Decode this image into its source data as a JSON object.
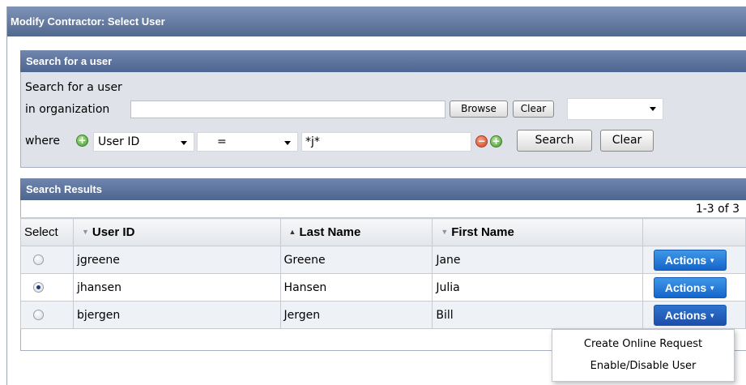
{
  "page": {
    "title": "Modify Contractor: Select User"
  },
  "search_panel": {
    "title": "Search for a user",
    "intro_line1": "Search for a user",
    "intro_line2": "in organization",
    "org_input_value": "",
    "browse_label": "Browse",
    "clear_org_label": "Clear",
    "org_dropdown_value": "",
    "where_label": "where",
    "attribute_select": "User ID",
    "operator_select": "=",
    "value_input": "*j*",
    "search_label": "Search",
    "clear_label": "Clear"
  },
  "results_panel": {
    "title": "Search Results",
    "range": "1-3 of 3",
    "columns": [
      "Select",
      "User ID",
      "Last Name",
      "First Name",
      ""
    ],
    "sort": {
      "User ID": "desc",
      "Last Name": "asc",
      "First Name": "desc"
    },
    "rows": [
      {
        "selected": false,
        "user_id": "jgreene",
        "last_name": "Greene",
        "first_name": "Jane",
        "action_label": "Actions"
      },
      {
        "selected": true,
        "user_id": "jhansen",
        "last_name": "Hansen",
        "first_name": "Julia",
        "action_label": "Actions"
      },
      {
        "selected": false,
        "user_id": "bjergen",
        "last_name": "Jergen",
        "first_name": "Bill",
        "action_label": "Actions"
      }
    ]
  },
  "actions_menu": {
    "items": [
      "Create Online Request",
      "Enable/Disable User"
    ]
  },
  "colors": {
    "header_gradient_top": "#7f93b8",
    "header_gradient_bottom": "#51688f",
    "actions_button": "#1565c9",
    "panel_background": "#dfe2e8"
  }
}
